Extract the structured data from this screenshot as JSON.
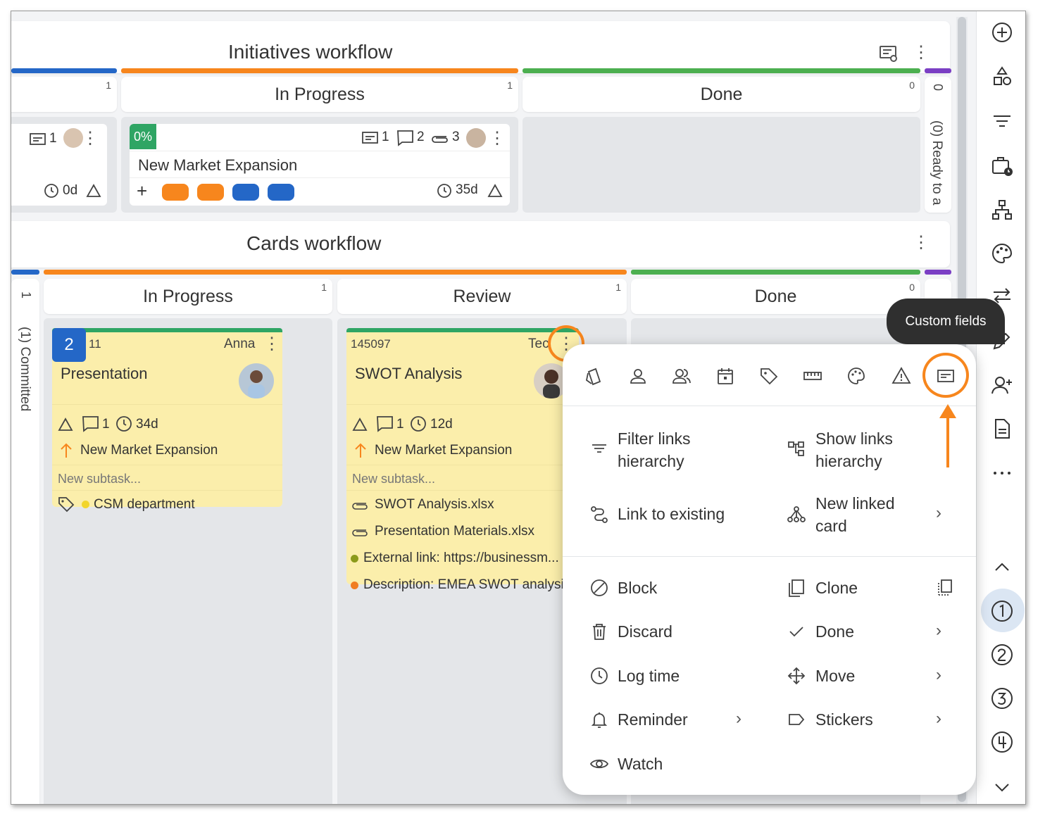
{
  "initiatives": {
    "title": "Initiatives workflow",
    "columns": [
      {
        "label": "In Progress",
        "count": "1"
      },
      {
        "label": "Done",
        "count": "0"
      }
    ],
    "left_count": "1",
    "collapsed": {
      "count": "0",
      "label": "(0) Ready to a"
    },
    "left_card": {
      "custom_count": "1",
      "time": "0d"
    },
    "card": {
      "progress": "0%",
      "custom_count": "1",
      "comments": "2",
      "attachments": "3",
      "title": "New Market Expansion",
      "add": "+",
      "time": "35d"
    }
  },
  "cards_workflow": {
    "title": "Cards workflow",
    "collapsed_left": {
      "count": "1",
      "label": "(1) Committed"
    },
    "columns": [
      {
        "label": "In Progress",
        "count": "1"
      },
      {
        "label": "Review",
        "count": "1"
      },
      {
        "label": "Done",
        "count": "0"
      }
    ],
    "card1": {
      "badge": "2",
      "id": "11",
      "owner": "Anna",
      "title": "Presentation",
      "comments": "1",
      "time": "34d",
      "parent": "New Market Expansion",
      "subtask_placeholder": "New subtask...",
      "tag": "CSM department"
    },
    "card2": {
      "id": "145097",
      "owner": "Tec",
      "title": "SWOT Analysis",
      "comments": "1",
      "time": "12d",
      "parent": "New Market Expansion",
      "subtask_placeholder": "New subtask...",
      "attachments": [
        "SWOT Analysis.xlsx",
        "Presentation Materials.xlsx"
      ],
      "fields": [
        {
          "label": "External link: https://businessm...",
          "color": "#8b9a1a"
        },
        {
          "label": "Description: EMEA SWOT analysi",
          "color": "#f07d21"
        }
      ]
    }
  },
  "tooltip": "Custom fields",
  "menu": {
    "top_icons": [
      "card-type-icon",
      "user-icon",
      "users-icon",
      "calendar-icon",
      "tag-icon",
      "ruler-icon",
      "palette-icon",
      "warning-icon",
      "custom-fields-icon"
    ],
    "links": {
      "filter": "Filter links hierarchy",
      "filter_l1": "Filter links",
      "filter_l2": "hierarchy",
      "show_l1": "Show links",
      "show_l2": "hierarchy",
      "link_existing": "Link to existing",
      "new_linked_l1": "New linked",
      "new_linked_l2": "card"
    },
    "actions": {
      "block": "Block",
      "clone": "Clone",
      "discard": "Discard",
      "done": "Done",
      "log_time": "Log time",
      "move": "Move",
      "reminder": "Reminder",
      "stickers": "Stickers",
      "watch": "Watch"
    }
  },
  "colors": {
    "orange": "#f7861d",
    "blue": "#2467c7",
    "green": "#4caf50",
    "purple": "#7b3fc4",
    "yellow_card": "#fbeeab"
  }
}
